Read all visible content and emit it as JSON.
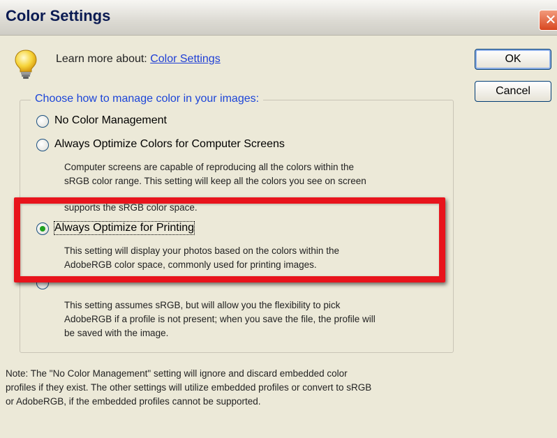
{
  "window": {
    "title": "Color Settings",
    "close_label": "✕"
  },
  "learn": {
    "prefix": "Learn more about:",
    "link": "Color Settings"
  },
  "buttons": {
    "ok": "OK",
    "cancel": "Cancel"
  },
  "group": {
    "legend": "Choose how to manage color in your images:",
    "options": [
      {
        "label": "No Color Management",
        "selected": false
      },
      {
        "label": "Always Optimize Colors for Computer Screens",
        "selected": false,
        "desc_lines": [
          "Computer screens are capable of reproducing all the colors within the",
          "sRGB color range. This setting will keep all the colors you see on screen",
          "supports the sRGB color space."
        ]
      },
      {
        "label": "Always Optimize for Printing",
        "selected": true,
        "desc_lines": [
          "This setting will display your photos based on the colors within the",
          "AdobeRGB color space, commonly used for printing images."
        ]
      },
      {
        "label": "",
        "selected": false,
        "desc_lines": [
          "This setting assumes sRGB, but will allow you the flexibility to pick",
          "AdobeRGB if a profile is not present; when you save the file, the profile will",
          "be saved with the image."
        ]
      }
    ]
  },
  "note": {
    "lines": [
      "Note: The \"No Color Management\" setting will ignore and discard embedded color",
      "profiles if they exist. The other settings will utilize embedded profiles or convert to sRGB",
      "or AdobeRGB, if the embedded profiles cannot be supported."
    ]
  },
  "colors": {
    "highlight": "#e8141c",
    "link": "#1f3fd6",
    "legend": "#1c45d8",
    "radio_checked": "#21a121"
  },
  "icons": {
    "bulb": "lightbulb-icon",
    "close": "close-icon"
  }
}
